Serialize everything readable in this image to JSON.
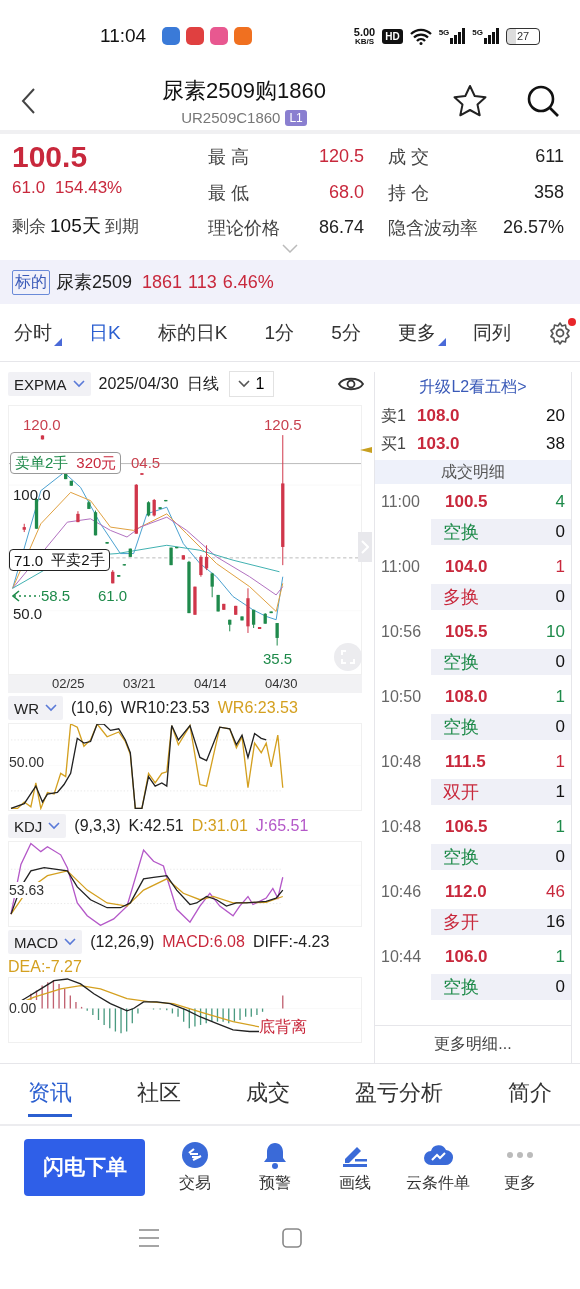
{
  "status_bar": {
    "time": "11:04",
    "net_speed": "5.00",
    "net_unit": "KB/S",
    "hd": "HD",
    "signals": [
      "5G",
      "5G"
    ],
    "battery": "27"
  },
  "header": {
    "title": "尿素2509购1860",
    "code": "UR2509C1860",
    "level_badge": "L1"
  },
  "quote": {
    "price": "100.5",
    "change": "61.0",
    "change_pct": "154.43%",
    "remaining": {
      "label": "剩余",
      "value": "105天",
      "suffix": "到期"
    },
    "stats": [
      {
        "label": "最 高",
        "value": "120.5",
        "color": "#c8283c"
      },
      {
        "label": "成 交",
        "value": "611",
        "color": "#222222"
      },
      {
        "label": "最 低",
        "value": "68.0",
        "color": "#c8283c"
      },
      {
        "label": "持 仓",
        "value": "358",
        "color": "#222222"
      },
      {
        "label": "理论价格",
        "value": "86.74",
        "color": "#222222"
      },
      {
        "label": "隐含波动率",
        "value": "26.57%",
        "color": "#222222"
      }
    ]
  },
  "underlying": {
    "tag": "标的",
    "name": "尿素2509",
    "price": "1861",
    "change": "113",
    "change_pct": "6.46%"
  },
  "period_tabs": [
    {
      "label": "分时",
      "selected": false,
      "dropdown": true
    },
    {
      "label": "日K",
      "selected": true,
      "dropdown": false
    },
    {
      "label": "标的日K",
      "selected": false,
      "dropdown": false
    },
    {
      "label": "1分",
      "selected": false,
      "dropdown": false
    },
    {
      "label": "5分",
      "selected": false,
      "dropdown": false
    },
    {
      "label": "更多",
      "selected": false,
      "dropdown": true
    },
    {
      "label": "同列",
      "selected": false,
      "dropdown": false
    }
  ],
  "settings_alert": true,
  "chart": {
    "indicator": "EXPMA",
    "date": "2025/04/30",
    "period": "日线",
    "count": "1",
    "price_labels": [
      {
        "text": "120.0",
        "color": "#c8404e"
      },
      {
        "text": "120.5",
        "color": "#c8404e"
      },
      {
        "text": "04.5",
        "color": "#c8404e"
      },
      {
        "text": "100.0",
        "color": "#222222"
      },
      {
        "text": "61.0",
        "color": "#1e8a4a"
      },
      {
        "text": "50.0",
        "color": "#222222"
      },
      {
        "text": "35.5",
        "color": "#1e8a4a"
      }
    ],
    "sell_order": {
      "label": "卖单2手",
      "amount": "320元"
    },
    "close_order": {
      "price": "71.0",
      "label": "平卖2手"
    },
    "cost_marker": "58.5",
    "dates": [
      "02/25",
      "03/21",
      "04/14",
      "04/30"
    ]
  },
  "indicators": [
    {
      "kind": "wr",
      "name": "WR",
      "params": "(10,6)",
      "axis_label": "50.00",
      "values": [
        {
          "text": "WR10:23.53",
          "color": "#222222"
        },
        {
          "text": "WR6:23.53",
          "color": "#d4a020"
        }
      ]
    },
    {
      "kind": "kdj",
      "name": "KDJ",
      "params": "(9,3,3)",
      "axis_label": "53.63",
      "values": [
        {
          "text": "K:42.51",
          "color": "#222222"
        },
        {
          "text": "D:31.01",
          "color": "#d4a020"
        },
        {
          "text": "J:65.51",
          "color": "#b458c8"
        }
      ]
    },
    {
      "kind": "macd",
      "name": "MACD",
      "params": "(12,26,9)",
      "axis_label": "0.00",
      "note": "底背离",
      "values": [
        {
          "text": "MACD:6.08",
          "color": "#c8283c"
        },
        {
          "text": "DIFF:-4.23",
          "color": "#222222"
        },
        {
          "text": "DEA:-7.27",
          "color": "#d4a020"
        }
      ]
    }
  ],
  "order_book": {
    "upgrade_link": "升级L2看五档>",
    "levels": [
      {
        "side": "卖1",
        "price": "108.0",
        "qty": "20"
      },
      {
        "side": "买1",
        "price": "103.0",
        "qty": "38"
      }
    ]
  },
  "trades_title": "成交明细",
  "trades": [
    {
      "time": "11:00",
      "price": "100.5",
      "volume": {
        "text": "4",
        "color": "#1e8a4a"
      },
      "type": {
        "text": "空换",
        "color": "#1e8a4a"
      },
      "count": "0"
    },
    {
      "time": "11:00",
      "price": "104.0",
      "volume": {
        "text": "1",
        "color": "#c8283c"
      },
      "type": {
        "text": "多换",
        "color": "#c8283c"
      },
      "count": "0"
    },
    {
      "time": "10:56",
      "price": "105.5",
      "volume": {
        "text": "10",
        "color": "#1e8a4a"
      },
      "type": {
        "text": "空换",
        "color": "#1e8a4a"
      },
      "count": "0"
    },
    {
      "time": "10:50",
      "price": "108.0",
      "volume": {
        "text": "1",
        "color": "#1e8a4a"
      },
      "type": {
        "text": "空换",
        "color": "#1e8a4a"
      },
      "count": "0"
    },
    {
      "time": "10:48",
      "price": "111.5",
      "volume": {
        "text": "1",
        "color": "#c8283c"
      },
      "type": {
        "text": "双开",
        "color": "#c8283c"
      },
      "count": "1"
    },
    {
      "time": "10:48",
      "price": "106.5",
      "volume": {
        "text": "1",
        "color": "#1e8a4a"
      },
      "type": {
        "text": "空换",
        "color": "#1e8a4a"
      },
      "count": "0"
    },
    {
      "time": "10:46",
      "price": "112.0",
      "volume": {
        "text": "46",
        "color": "#c8283c"
      },
      "type": {
        "text": "多开",
        "color": "#c8283c"
      },
      "count": "16"
    },
    {
      "time": "10:44",
      "price": "106.0",
      "volume": {
        "text": "1",
        "color": "#1e8a4a"
      },
      "type": {
        "text": "空换",
        "color": "#1e8a4a"
      },
      "count": "0"
    }
  ],
  "more_trades": "更多明细...",
  "bottom_tabs": [
    {
      "label": "资讯",
      "selected": true
    },
    {
      "label": "社区",
      "selected": false
    },
    {
      "label": "成交",
      "selected": false
    },
    {
      "label": "盈亏分析",
      "selected": false
    },
    {
      "label": "简介",
      "selected": false
    }
  ],
  "actions": {
    "primary": "闪电下单",
    "tools": [
      {
        "kind": "trade",
        "label": "交易"
      },
      {
        "kind": "alert",
        "label": "预警"
      },
      {
        "kind": "draw",
        "label": "画线"
      },
      {
        "kind": "cloud",
        "label": "云条件单"
      },
      {
        "kind": "more",
        "label": "更多"
      }
    ]
  }
}
